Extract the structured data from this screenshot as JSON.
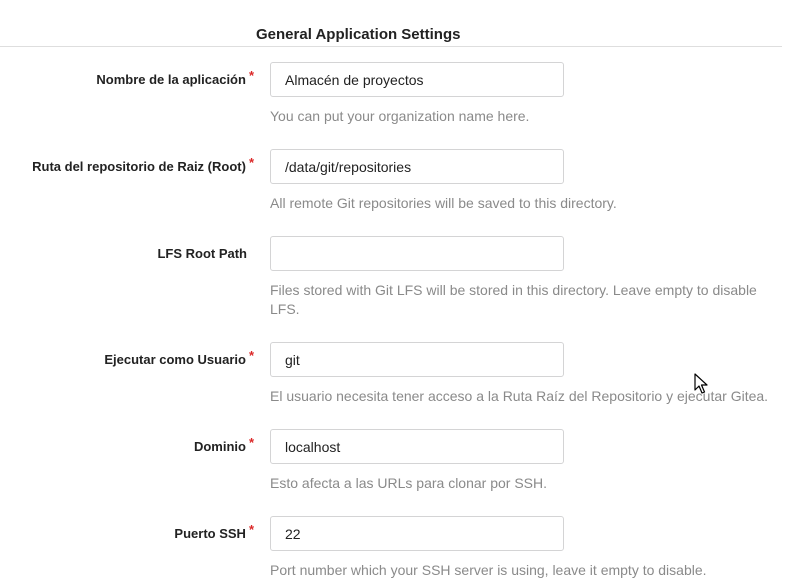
{
  "section": {
    "title": "General Application Settings"
  },
  "fields": [
    {
      "label": "Nombre de la aplicación",
      "required": true,
      "value": "Almacén de proyectos",
      "help": "You can put your organization name here."
    },
    {
      "label": "Ruta del repositorio de Raiz (Root)",
      "required": true,
      "value": "/data/git/repositories",
      "help": "All remote Git repositories will be saved to this directory."
    },
    {
      "label": "LFS Root Path",
      "required": false,
      "value": "",
      "help": "Files stored with Git LFS will be stored in this directory. Leave empty to disable LFS."
    },
    {
      "label": "Ejecutar como Usuario",
      "required": true,
      "value": "git",
      "help": "El usuario necesita tener acceso a la Ruta Raíz del Repositorio y ejecutar Gitea."
    },
    {
      "label": "Dominio",
      "required": true,
      "value": "localhost",
      "help": "Esto afecta a las URLs para clonar por SSH."
    },
    {
      "label": "Puerto SSH",
      "required": true,
      "value": "22",
      "help": "Port number which your SSH server is using, leave it empty to disable."
    }
  ],
  "required_mark": "*",
  "colors": {
    "required": "#db2828",
    "help_text": "#8a8a8a",
    "input_border": "#d4d4d5"
  }
}
